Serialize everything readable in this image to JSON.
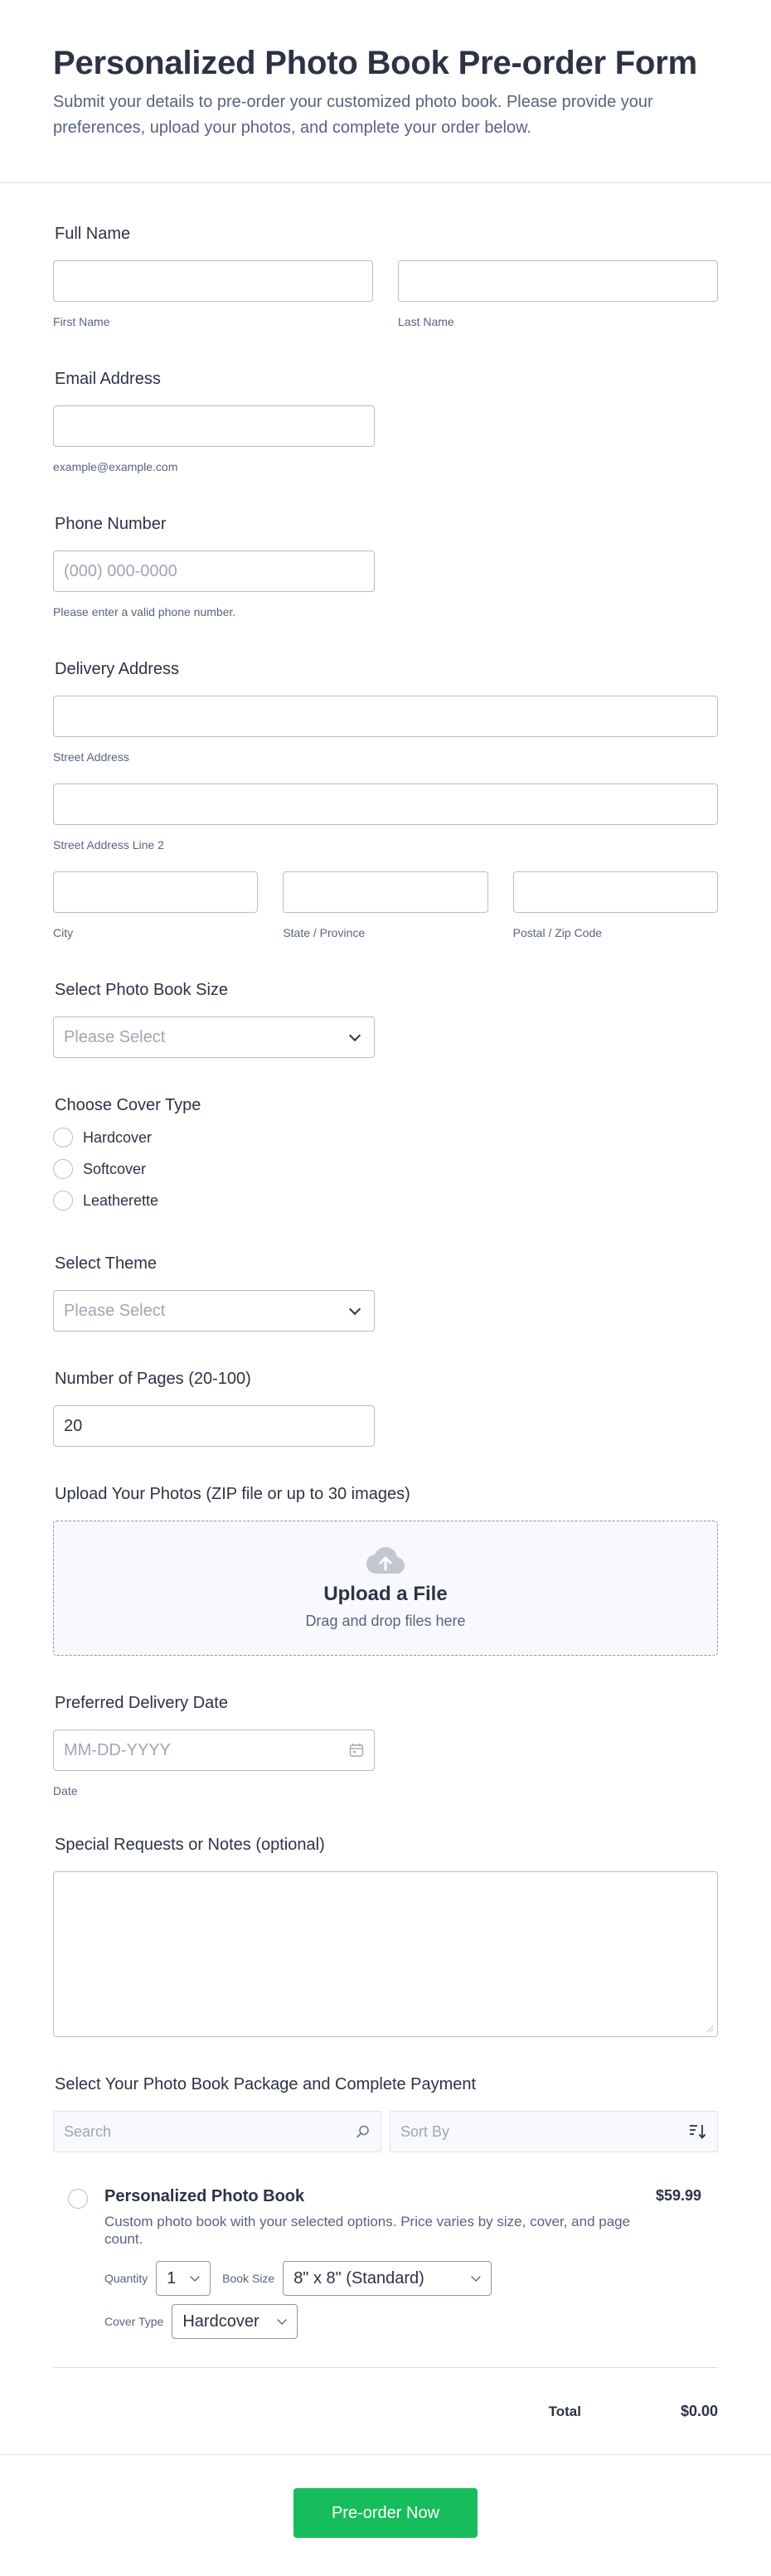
{
  "header": {
    "title": "Personalized Photo Book Pre-order Form",
    "subtitle": "Submit your details to pre-order your customized photo book. Please provide your preferences, upload your photos, and complete your order below."
  },
  "full_name": {
    "label": "Full Name",
    "first_sublabel": "First Name",
    "last_sublabel": "Last Name"
  },
  "email": {
    "label": "Email Address",
    "sublabel": "example@example.com"
  },
  "phone": {
    "label": "Phone Number",
    "placeholder": "(000) 000-0000",
    "sublabel": "Please enter a valid phone number."
  },
  "address": {
    "label": "Delivery Address",
    "street": "Street Address",
    "street2": "Street Address Line 2",
    "city": "City",
    "state": "State / Province",
    "zip": "Postal / Zip Code"
  },
  "size": {
    "label": "Select Photo Book Size",
    "placeholder": "Please Select"
  },
  "cover": {
    "label": "Choose Cover Type",
    "options": [
      "Hardcover",
      "Softcover",
      "Leatherette"
    ]
  },
  "theme": {
    "label": "Select Theme",
    "placeholder": "Please Select"
  },
  "pages": {
    "label": "Number of Pages (20-100)",
    "value": "20"
  },
  "upload": {
    "label": "Upload Your Photos (ZIP file or up to 30 images)",
    "title": "Upload a File",
    "desc": "Drag and drop files here"
  },
  "delivery_date": {
    "label": "Preferred Delivery Date",
    "placeholder": "MM-DD-YYYY",
    "sublabel": "Date"
  },
  "notes": {
    "label": "Special Requests or Notes (optional)"
  },
  "payment": {
    "label": "Select Your Photo Book Package and Complete Payment",
    "search_placeholder": "Search",
    "sort_placeholder": "Sort By",
    "product": {
      "name": "Personalized Photo Book",
      "desc": "Custom photo book with your selected options. Price varies by size, cover, and page count.",
      "price": "$59.99",
      "quantity_label": "Quantity",
      "quantity_value": "1",
      "book_size_label": "Book Size",
      "book_size_value": "8\" x 8\" (Standard)",
      "cover_label": "Cover Type",
      "cover_value": "Hardcover"
    },
    "total_label": "Total",
    "total_value": "$0.00"
  },
  "submit_label": "Pre-order Now",
  "colors": {
    "submit": "#18bd5b",
    "text": "#2c3345",
    "muted": "#57647e",
    "border": "#b8bdc9"
  }
}
